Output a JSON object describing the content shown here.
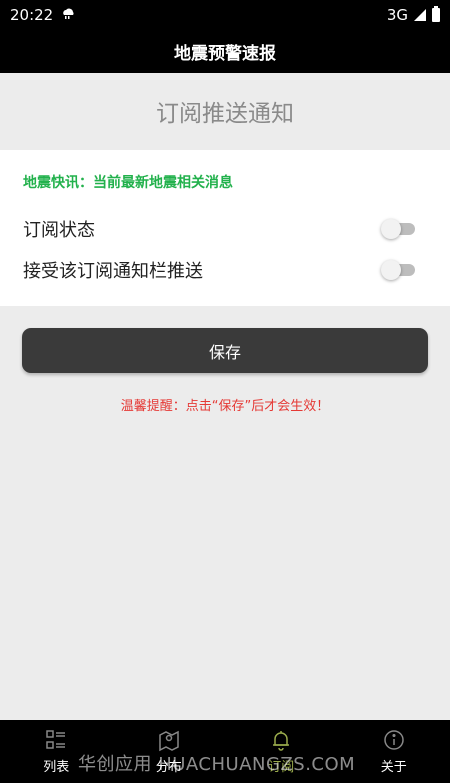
{
  "status_bar": {
    "time": "20:22",
    "network": "3G"
  },
  "title_bar": {
    "title": "地震预警速报"
  },
  "section": {
    "heading": "订阅推送通知"
  },
  "card": {
    "info": "地震快讯：当前最新地震相关消息",
    "rows": [
      {
        "label": "订阅状态",
        "toggle_on": false
      },
      {
        "label": "接受该订阅通知栏推送",
        "toggle_on": false
      }
    ]
  },
  "save_button": {
    "label": "保存"
  },
  "hint": {
    "text": "温馨提醒：点击“保存”后才会生效！"
  },
  "bottom_nav": {
    "items": [
      {
        "label": "列表",
        "icon": "list-icon",
        "active": false
      },
      {
        "label": "分布",
        "icon": "map-icon",
        "active": false
      },
      {
        "label": "订阅",
        "icon": "bell-icon",
        "active": true
      },
      {
        "label": "关于",
        "icon": "info-icon",
        "active": false
      }
    ]
  },
  "watermark": {
    "text": "华创应用 HUACHUANGZS.COM"
  },
  "colors": {
    "accent_green": "#22b14c",
    "hint_red": "#e53935",
    "active_nav": "#9aab4c"
  }
}
